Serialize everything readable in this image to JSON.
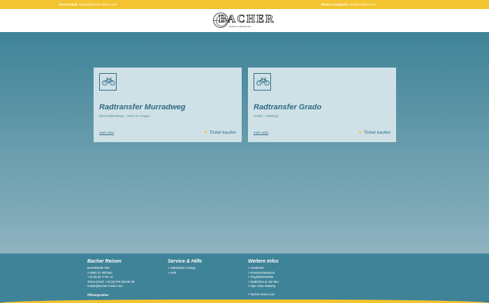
{
  "topbar": {
    "service_label": "Service-Mail:",
    "service_email": "urlaub@bacher-reisen.com",
    "more_label": "Weitere Angebote:",
    "more_link": "bacher-reisen.com"
  },
  "brand": {
    "name": "BACHER",
    "tagline": "... Komfort und Sicherheit seit ..."
  },
  "cards": [
    {
      "icon": "bicycle-icon",
      "title": "Radtransfer Murradweg",
      "route": "Bad Radkersburg – Muhr im Lungau",
      "more": "mehr Infos",
      "ticket": "Ticket kaufen"
    },
    {
      "icon": "bicycle-icon",
      "title": "Radtransfer Grado",
      "route": "Grado – Salzburg",
      "more": "mehr Infos",
      "ticket": "Ticket kaufen"
    }
  ],
  "footer": {
    "company": {
      "heading": "Bacher Reisen",
      "lines": [
        "Murtalstraße 584",
        "A-5582 St. Michael",
        "+43 (0) 64 77 81 11",
        "Ticket Notruf: +43 (0) 676 948 89 39",
        "urlaub@bacher-reisen.com"
      ],
      "hours": "Öffnungszeiten"
    },
    "service": {
      "heading": "Service & Hilfe",
      "links": [
        "> Individuelle Anfrage",
        "> AGB"
      ]
    },
    "more": {
      "heading": "Weitere Infos",
      "links": [
        "> Taxidienst",
        "> Krankentransporte",
        "> Flughafentransfer",
        "> Radlerbus an der Mur",
        "> Alpe Adria Radweg"
      ],
      "site": "> bacher-reisen.com"
    }
  },
  "colors": {
    "yellow": "#f4c430",
    "teal": "#3f8398",
    "card": "#cfe1e7",
    "text_blue": "#2f6c84"
  }
}
